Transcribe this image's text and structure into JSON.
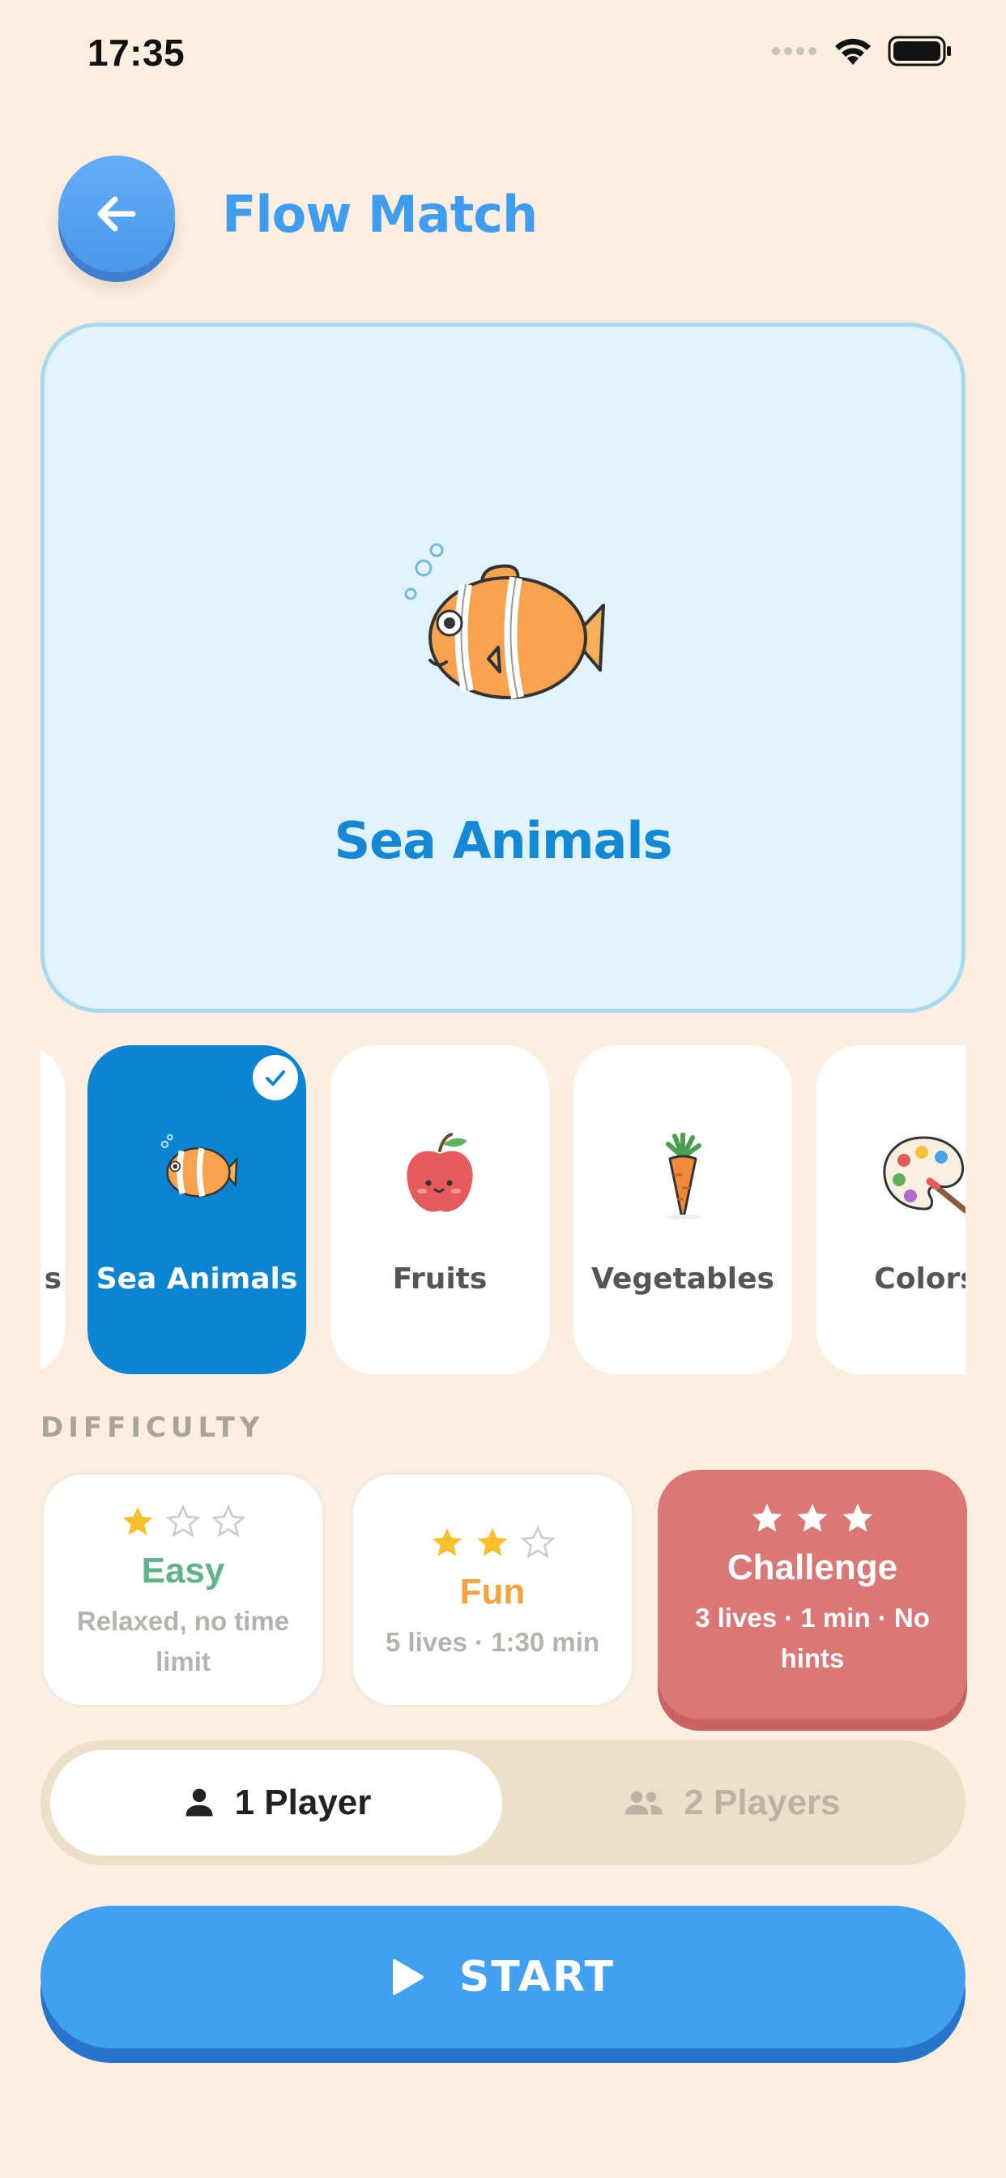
{
  "status_bar": {
    "time": "17:35"
  },
  "header": {
    "title": "Flow Match",
    "back_icon": "arrow-left-icon"
  },
  "hero": {
    "title": "Sea Animals",
    "icon": "clownfish-icon"
  },
  "categories": [
    {
      "label": "s",
      "icon": "none",
      "selected": false
    },
    {
      "label": "Sea Animals",
      "icon": "clownfish-icon",
      "selected": true
    },
    {
      "label": "Fruits",
      "icon": "apple-icon",
      "selected": false
    },
    {
      "label": "Vegetables",
      "icon": "carrot-icon",
      "selected": false
    },
    {
      "label": "Colors",
      "icon": "palette-icon",
      "selected": false
    }
  ],
  "difficulty": {
    "section_label": "DIFFICULTY",
    "options": [
      {
        "name": "Easy",
        "description": "Relaxed, no time limit",
        "stars_filled": 1,
        "stars_total": 3,
        "color": "#5fb388",
        "selected": false
      },
      {
        "name": "Fun",
        "description": "5 lives · 1:30 min",
        "stars_filled": 2,
        "stars_total": 3,
        "color": "#f3a33a",
        "selected": false
      },
      {
        "name": "Challenge",
        "description": "3 lives · 1 min · No hints",
        "stars_filled": 3,
        "stars_total": 3,
        "color": "#d97876",
        "selected": true
      }
    ]
  },
  "players": {
    "one": {
      "label": "1 Player",
      "icon": "person-icon",
      "selected": true
    },
    "two": {
      "label": "2 Players",
      "icon": "people-icon",
      "selected": false
    }
  },
  "start": {
    "label": "START",
    "icon": "play-icon"
  },
  "colors": {
    "accent": "#41a0ef",
    "selected_card": "#0b85d2",
    "background": "#fdefdf"
  }
}
